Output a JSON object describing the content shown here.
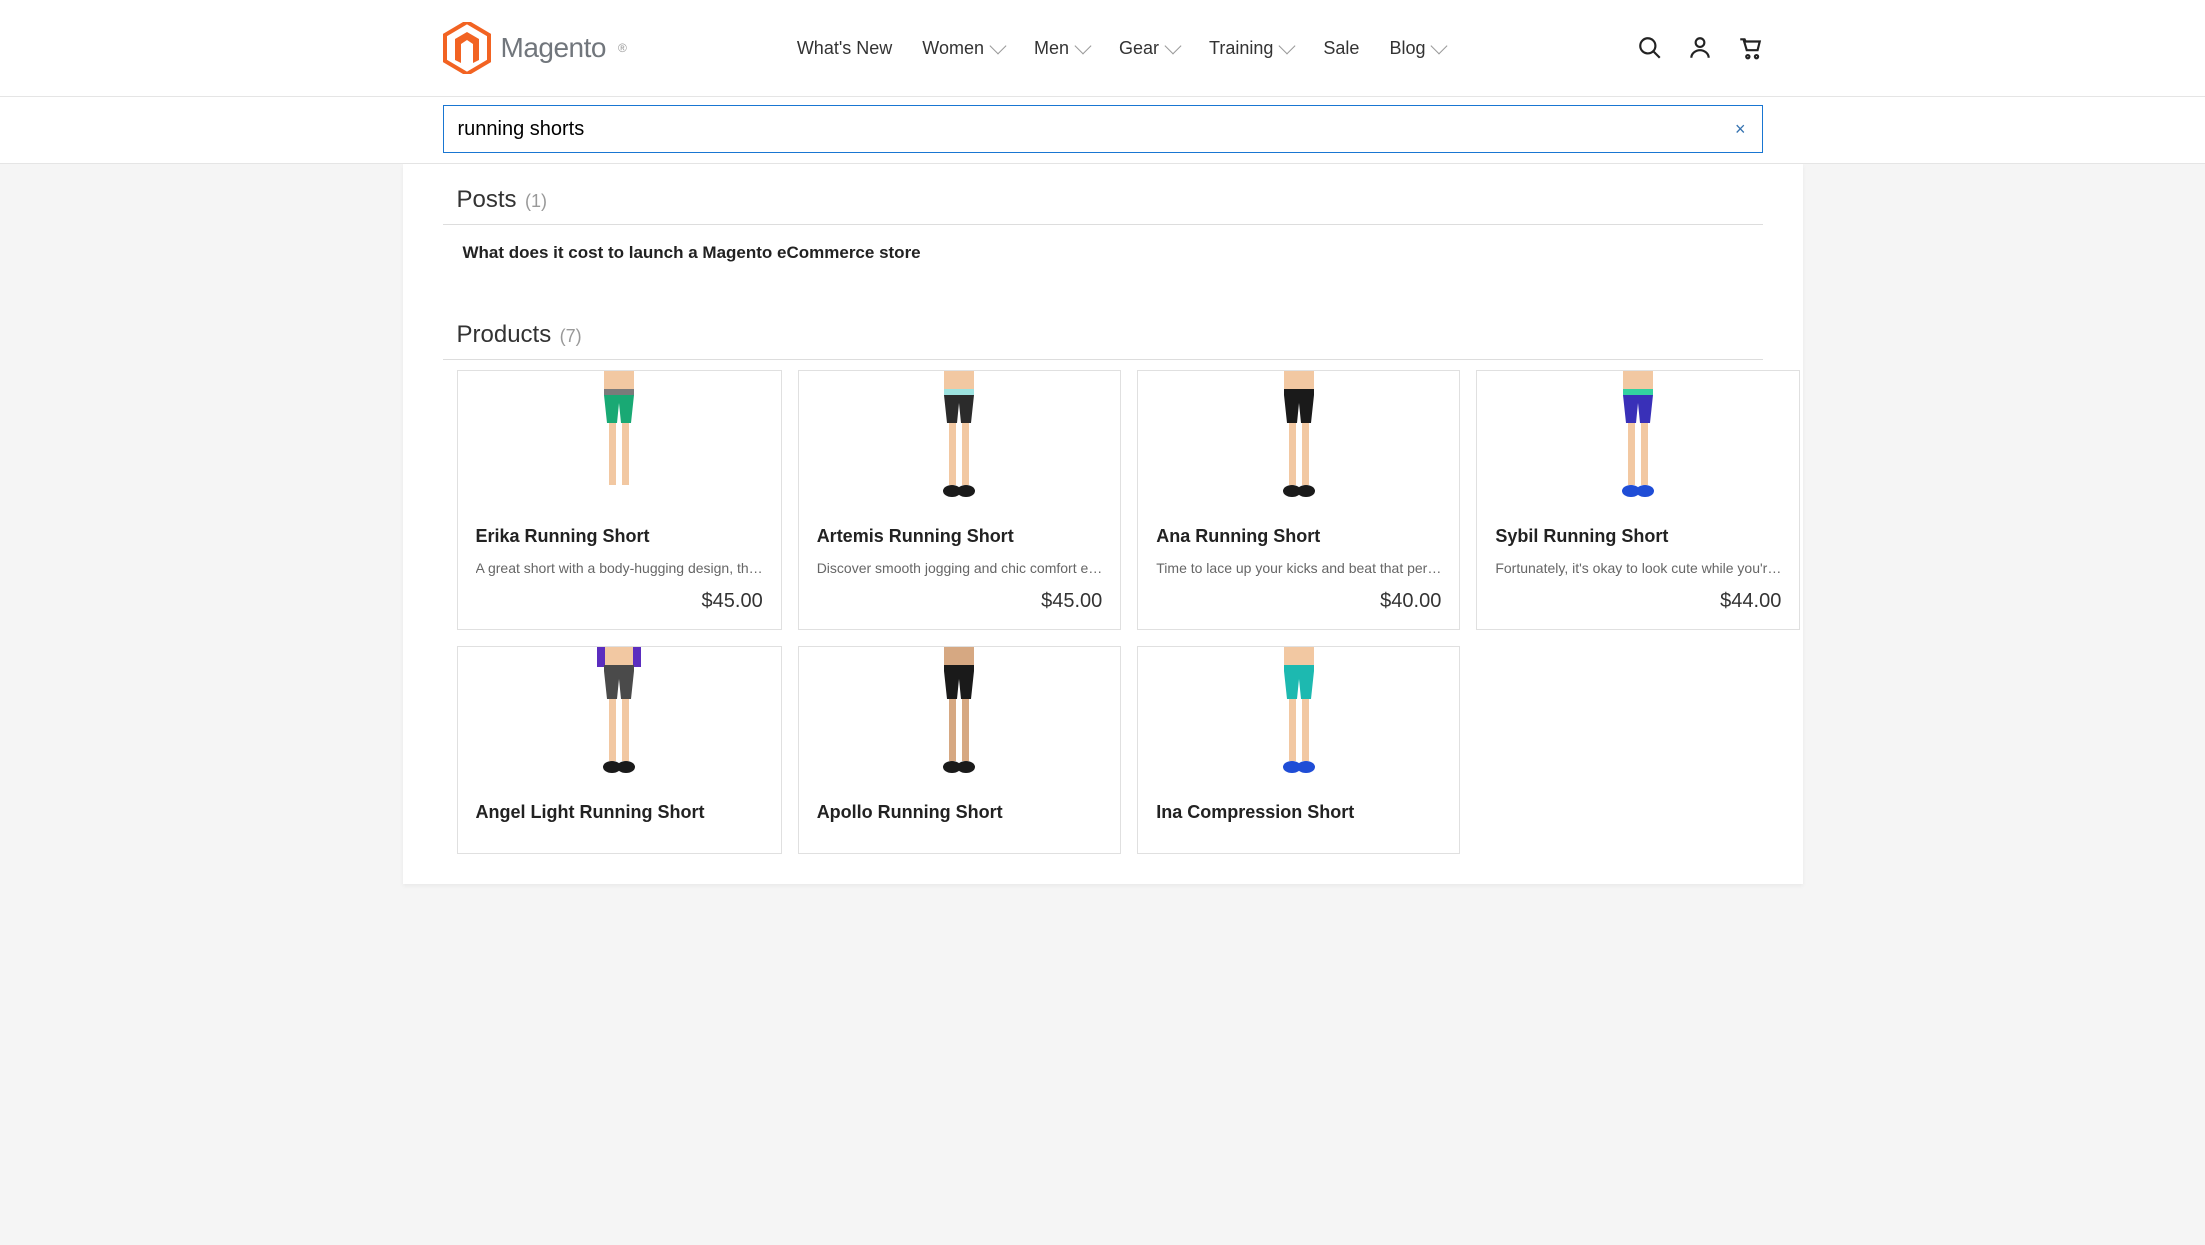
{
  "brand": {
    "name": "Magento",
    "color": "#f26322"
  },
  "nav": [
    {
      "label": "What's New",
      "dropdown": false
    },
    {
      "label": "Women",
      "dropdown": true
    },
    {
      "label": "Men",
      "dropdown": true
    },
    {
      "label": "Gear",
      "dropdown": true
    },
    {
      "label": "Training",
      "dropdown": true
    },
    {
      "label": "Sale",
      "dropdown": false
    },
    {
      "label": "Blog",
      "dropdown": true
    }
  ],
  "search": {
    "value": "running shorts",
    "clear_icon_label": "×"
  },
  "posts": {
    "title": "Posts",
    "count": "(1)",
    "items": [
      {
        "title": "What does it cost to launch a Magento eCommerce store"
      }
    ]
  },
  "products": {
    "title": "Products",
    "count": "(7)",
    "items": [
      {
        "name": "Erika Running Short",
        "desc": "A great short with a body-hugging design, th…",
        "price": "$45.00",
        "colors": {
          "shorts": "#19a974",
          "waist": "#7a7a7a",
          "skin": "#f2c8a2",
          "shoe": "#ffffff"
        }
      },
      {
        "name": "Artemis Running Short",
        "desc": "Discover smooth jogging and chic comfort e…",
        "price": "$45.00",
        "colors": {
          "shorts": "#2b2b2b",
          "waist": "#9de2df",
          "skin": "#f2c8a2",
          "shoe": "#1a1a1a"
        }
      },
      {
        "name": "Ana Running Short",
        "desc": "Time to lace up your kicks and beat that per…",
        "price": "$40.00",
        "colors": {
          "shorts": "#1a1a1a",
          "waist": "#1a1a1a",
          "skin": "#f2c8a2",
          "shoe": "#1a1a1a"
        }
      },
      {
        "name": "Sybil Running Short",
        "desc": "Fortunately, it's okay to look cute while you'r…",
        "price": "$44.00",
        "colors": {
          "shorts": "#3930b8",
          "waist": "#33d1a0",
          "skin": "#f2c8a2",
          "shoe": "#1f4dd6"
        }
      },
      {
        "name": "Angel Light Running Short",
        "desc": "",
        "price": "",
        "colors": {
          "shorts": "#4a4a4a",
          "waist": "#4a4a4a",
          "skin": "#f2c8a2",
          "shoe": "#1a1a1a",
          "sleeve": "#5b2dbf"
        }
      },
      {
        "name": "Apollo Running Short",
        "desc": "",
        "price": "",
        "colors": {
          "shorts": "#1a1a1a",
          "waist": "#1a1a1a",
          "skin": "#d6a882",
          "shoe": "#1a1a1a"
        }
      },
      {
        "name": "Ina Compression Short",
        "desc": "",
        "price": "",
        "colors": {
          "shorts": "#1db9b0",
          "waist": "#1db9b0",
          "skin": "#f2c8a2",
          "shoe": "#1f4dd6"
        }
      }
    ]
  }
}
